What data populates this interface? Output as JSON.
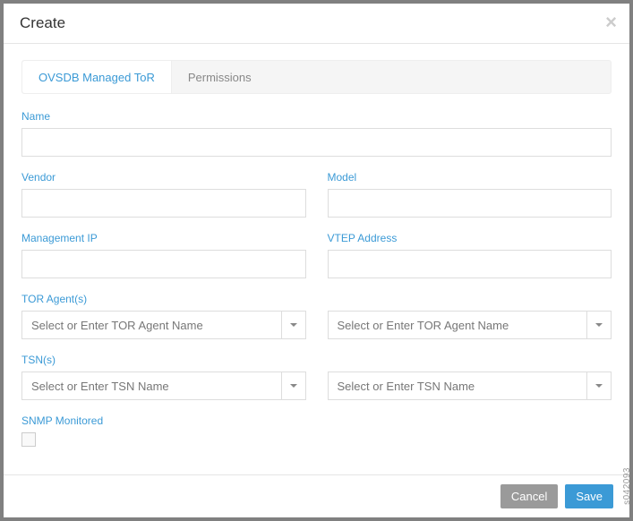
{
  "modal": {
    "title": "Create"
  },
  "tabs": {
    "items": [
      {
        "label": "OVSDB Managed ToR",
        "active": true
      },
      {
        "label": "Permissions",
        "active": false
      }
    ]
  },
  "form": {
    "name_label": "Name",
    "name_value": "",
    "vendor_label": "Vendor",
    "vendor_value": "",
    "model_label": "Model",
    "model_value": "",
    "mgmt_ip_label": "Management IP",
    "mgmt_ip_value": "",
    "vtep_label": "VTEP Address",
    "vtep_value": "",
    "tor_agents_label": "TOR Agent(s)",
    "tor_agent_placeholder": "Select or Enter TOR Agent Name",
    "tsn_label": "TSN(s)",
    "tsn_placeholder": "Select or Enter TSN Name",
    "snmp_label": "SNMP Monitored",
    "snmp_checked": false
  },
  "footer": {
    "cancel_label": "Cancel",
    "save_label": "Save"
  },
  "side_code": "s042093"
}
